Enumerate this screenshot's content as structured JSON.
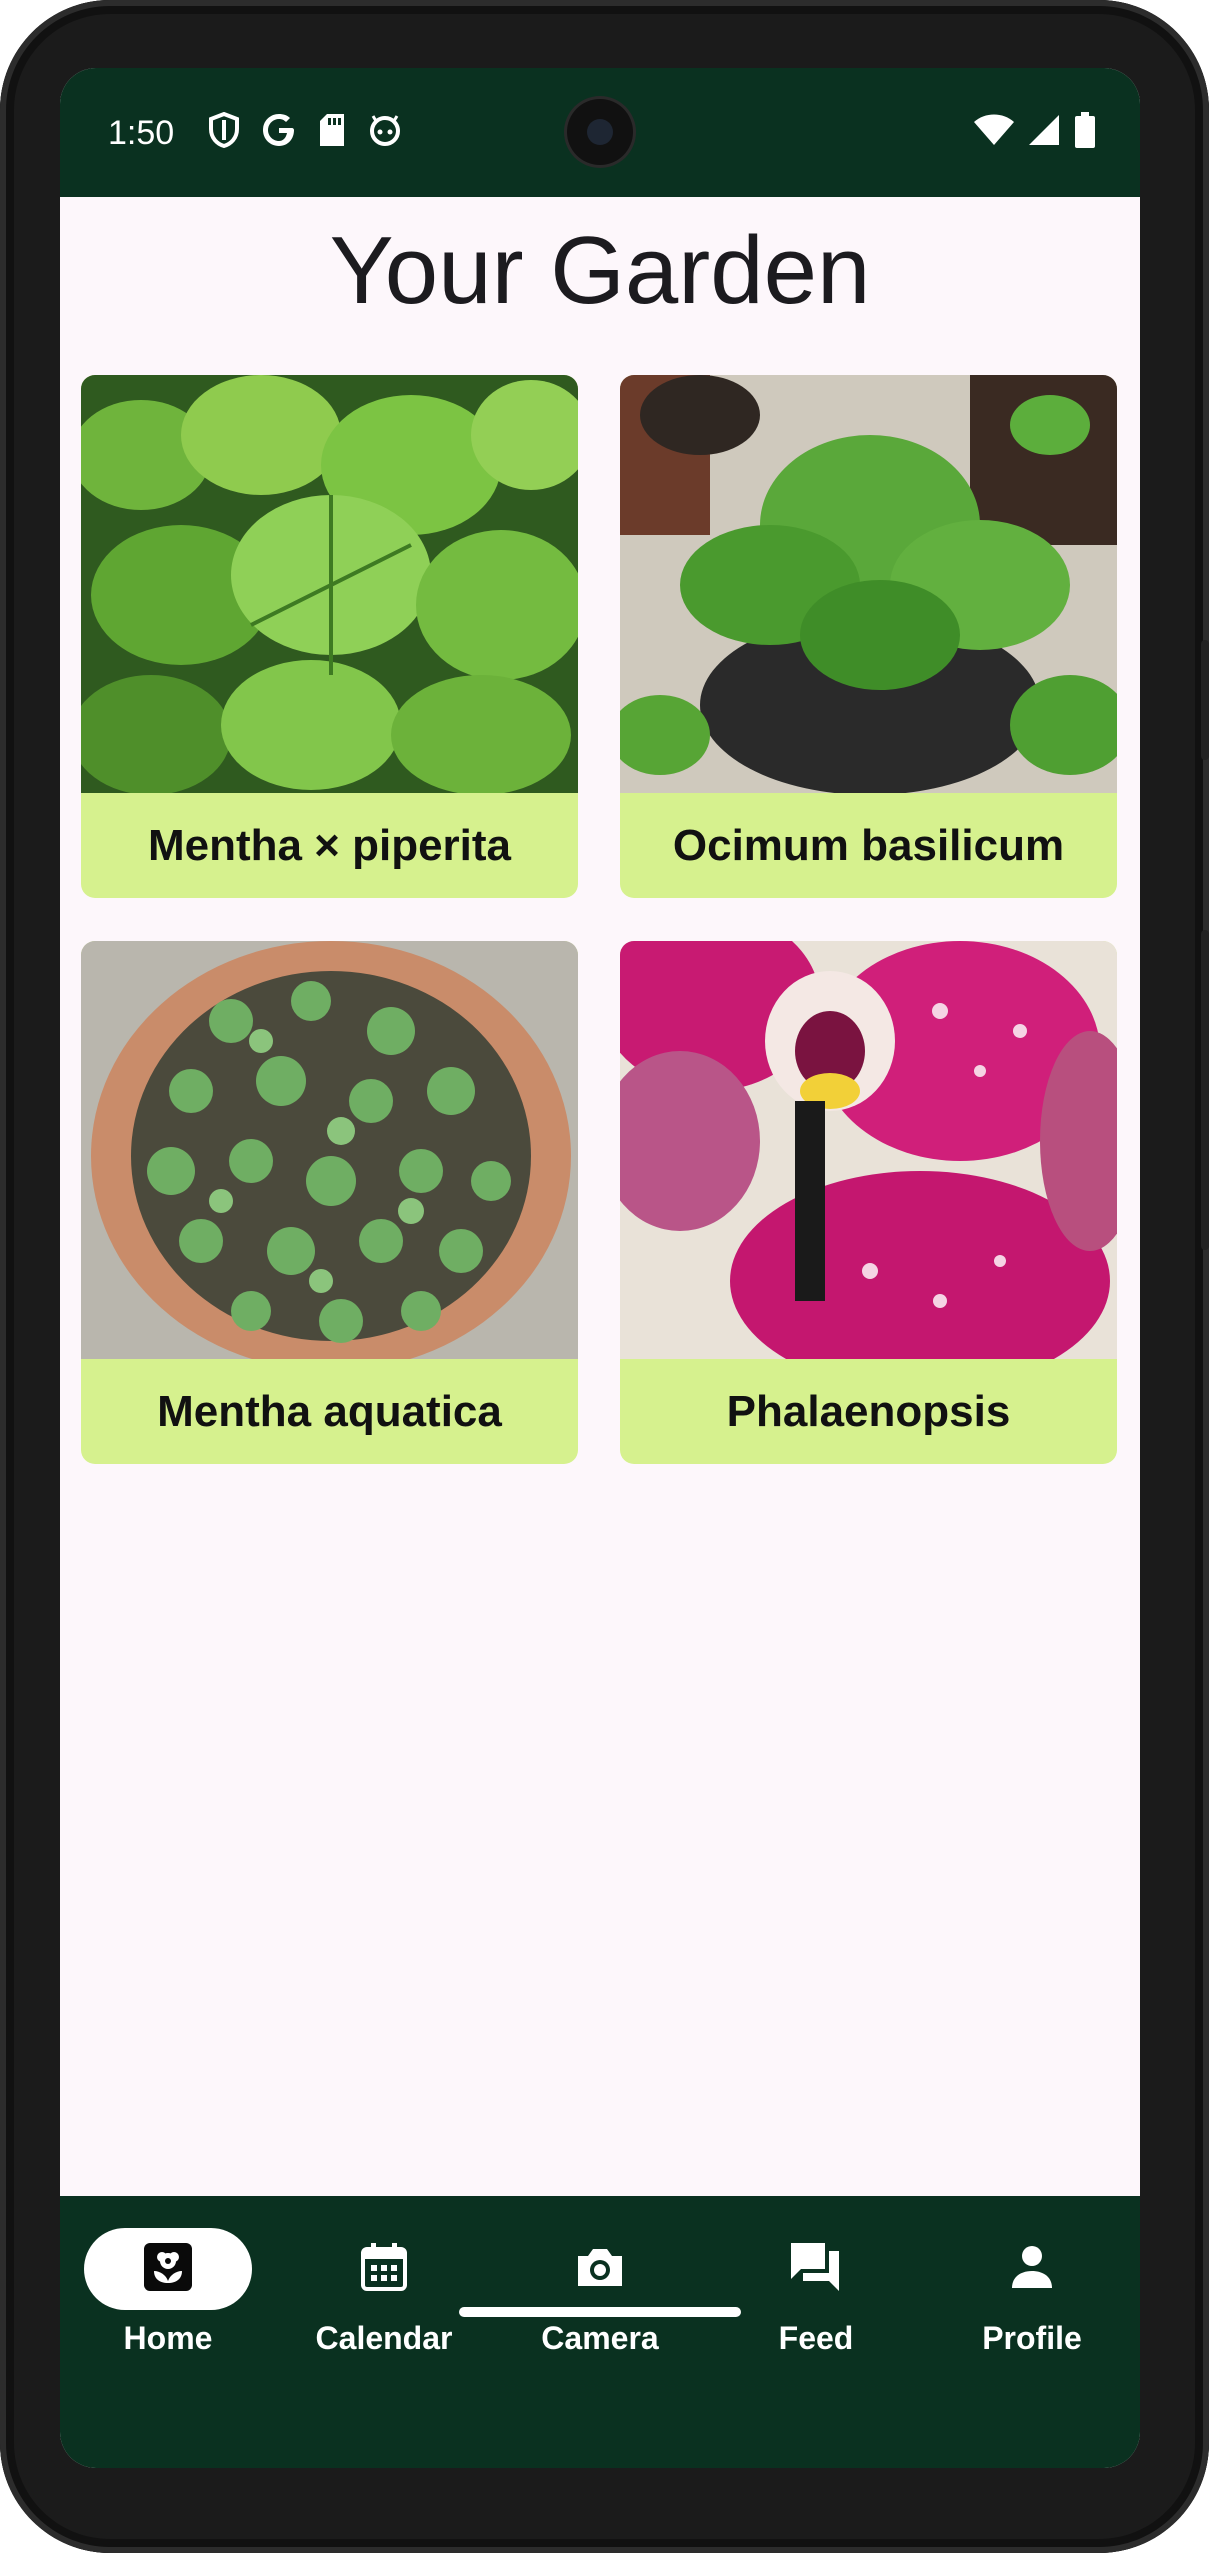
{
  "status_bar": {
    "time": "1:50",
    "left_icons": [
      "shield-icon",
      "google-icon",
      "sd-card-icon",
      "android-icon"
    ],
    "right_icons": [
      "wifi-icon",
      "signal-icon",
      "battery-icon"
    ]
  },
  "page": {
    "title": "Your Garden"
  },
  "plants": [
    {
      "name": "Mentha × piperita",
      "image": "mint-leaves-photo"
    },
    {
      "name": "Ocimum basilicum",
      "image": "basil-pots-photo"
    },
    {
      "name": "Mentha aquatica",
      "image": "water-mint-pot-photo"
    },
    {
      "name": "Phalaenopsis",
      "image": "orchid-photo"
    }
  ],
  "bottom_nav": {
    "items": [
      {
        "label": "Home",
        "icon": "home-plant-icon",
        "active": true
      },
      {
        "label": "Calendar",
        "icon": "calendar-icon",
        "active": false
      },
      {
        "label": "Camera",
        "icon": "camera-icon",
        "active": false
      },
      {
        "label": "Feed",
        "icon": "chat-bubbles-icon",
        "active": false
      },
      {
        "label": "Profile",
        "icon": "person-icon",
        "active": false
      }
    ]
  },
  "colors": {
    "bar_bg": "#0a3120",
    "card_label_bg": "#d6f18e",
    "screen_bg": "#fdf7fb"
  }
}
